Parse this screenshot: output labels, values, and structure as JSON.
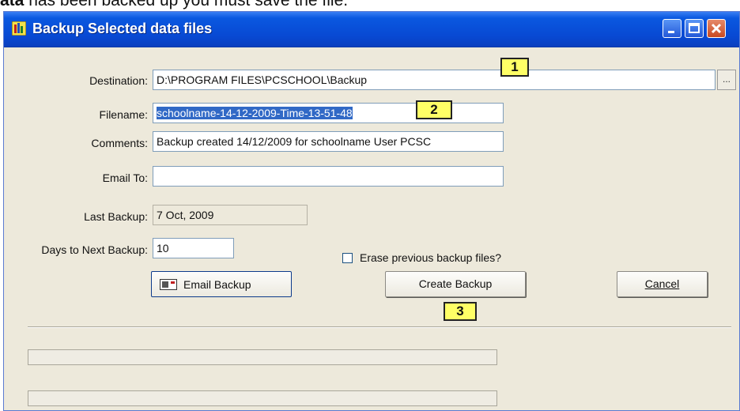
{
  "caption": {
    "bold": "ata",
    "rest": " has been backed up you must save the file."
  },
  "window": {
    "title": "Backup Selected data files"
  },
  "colors": {
    "titlebar": "#0849d3",
    "marker": "#ffff66",
    "selection": "#3169c6"
  },
  "form": {
    "destination": {
      "label": "Destination:",
      "value": "D:\\PROGRAM FILES\\PCSCHOOL\\Backup",
      "browse": "..."
    },
    "filename": {
      "label": "Filename:",
      "value": "schoolname-14-12-2009-Time-13-51-48"
    },
    "comments": {
      "label": "Comments:",
      "value": "Backup  created 14/12/2009 for schoolname User PCSC"
    },
    "email_to": {
      "label": "Email To:",
      "value": ""
    },
    "last_backup": {
      "label": "Last Backup:",
      "value": "7 Oct, 2009"
    },
    "days_to_next": {
      "label": "Days to Next Backup:",
      "value": "10"
    },
    "erase_previous": {
      "label": "Erase previous backup files?",
      "checked": false
    }
  },
  "buttons": {
    "email_backup": "Email Backup",
    "create_backup": "Create Backup",
    "cancel": "Cancel"
  },
  "markers": [
    "1",
    "2",
    "3"
  ],
  "progress": {
    "bar1": 0,
    "bar2": 0
  }
}
